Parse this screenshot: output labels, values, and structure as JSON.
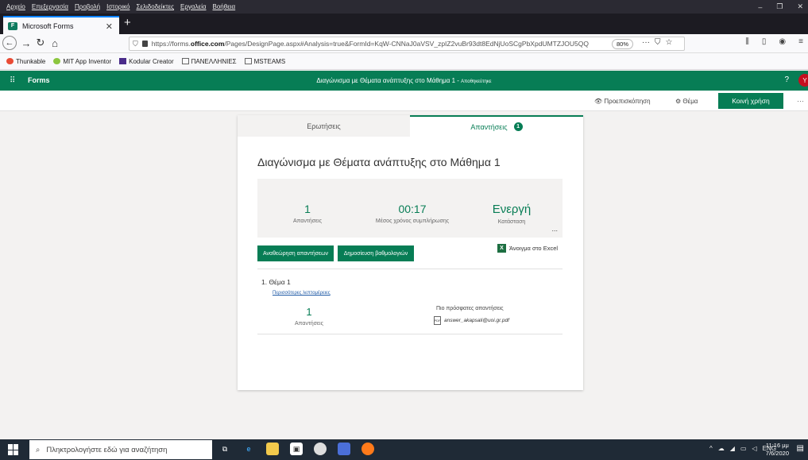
{
  "menubar": {
    "items": [
      "Αρχείο",
      "Επεξεργασία",
      "Προβολή",
      "Ιστορικό",
      "Σελιδοδείκτες",
      "Εργαλεία",
      "Βοήθεια"
    ],
    "controls": [
      "–",
      "❐",
      "✕"
    ]
  },
  "browser": {
    "tab_title": "Microsoft Forms",
    "tab_close": "✕",
    "new_tab": "+",
    "url_prefix": "https://forms.",
    "url_domain": "office.com",
    "url_rest": "/Pages/DesignPage.aspx#Analysis=true&FormId=KqW-CNNaJ0aVSV_zpIZ2vuBr93dt8EdNjUoSCgPbXpdUMTZJOU5QQ",
    "zoom": "80%",
    "url_actions": [
      "···",
      "⛉",
      "☆"
    ]
  },
  "bookmarks": [
    "Thunkable",
    "MIT App Inventor",
    "Kodular Creator",
    "ΠΑΝΕΛΛΗΝΙΕΣ",
    "MSTEAMS"
  ],
  "appbar": {
    "app_name": "Forms",
    "form_title": "Διαγώνισμα με Θέματα ανάπτυξης στο Μάθημα 1",
    "saved_status": "Αποθηκεύτηκε",
    "help": "?",
    "avatar_letter": "Y"
  },
  "commandbar": {
    "preview": "Προεπισκόπηση",
    "theme": "Θέμα",
    "share": "Κοινή χρήση",
    "more": "···"
  },
  "card": {
    "tab_questions": "Ερωτήσεις",
    "tab_responses": "Απαντήσεις",
    "responses_badge": "1",
    "title": "Διαγώνισμα με Θέματα ανάπτυξης στο Μάθημα 1",
    "stats": {
      "responses_value": "1",
      "responses_label": "Απαντήσεις",
      "avg_time_value": "00:17",
      "avg_time_label": "Μέσος χρόνος συμπλήρωσης",
      "status_value": "Ενεργή",
      "status_label": "Κατάσταση",
      "more": "..."
    },
    "review_button": "Αναθεώρηση απαντήσεων",
    "publish_button": "Δημοσίευση βαθμολογιών",
    "excel_label": "Άνοιγμα στο Excel",
    "question": {
      "title": "1. Θέμα 1",
      "details_link": "Περισσότερες λεπτομέρειες",
      "count_value": "1",
      "count_label": "Απαντήσεις",
      "recent_label": "Πιο πρόσφατες απαντήσεις",
      "recent_file": "answer_akapsali@uoi.gr.pdf"
    }
  },
  "taskbar": {
    "search_placeholder": "Πληκτρολογήστε εδώ για αναζήτηση",
    "tray_lang": "ENG",
    "time": "11:16 μμ",
    "date": "7/6/2020"
  }
}
